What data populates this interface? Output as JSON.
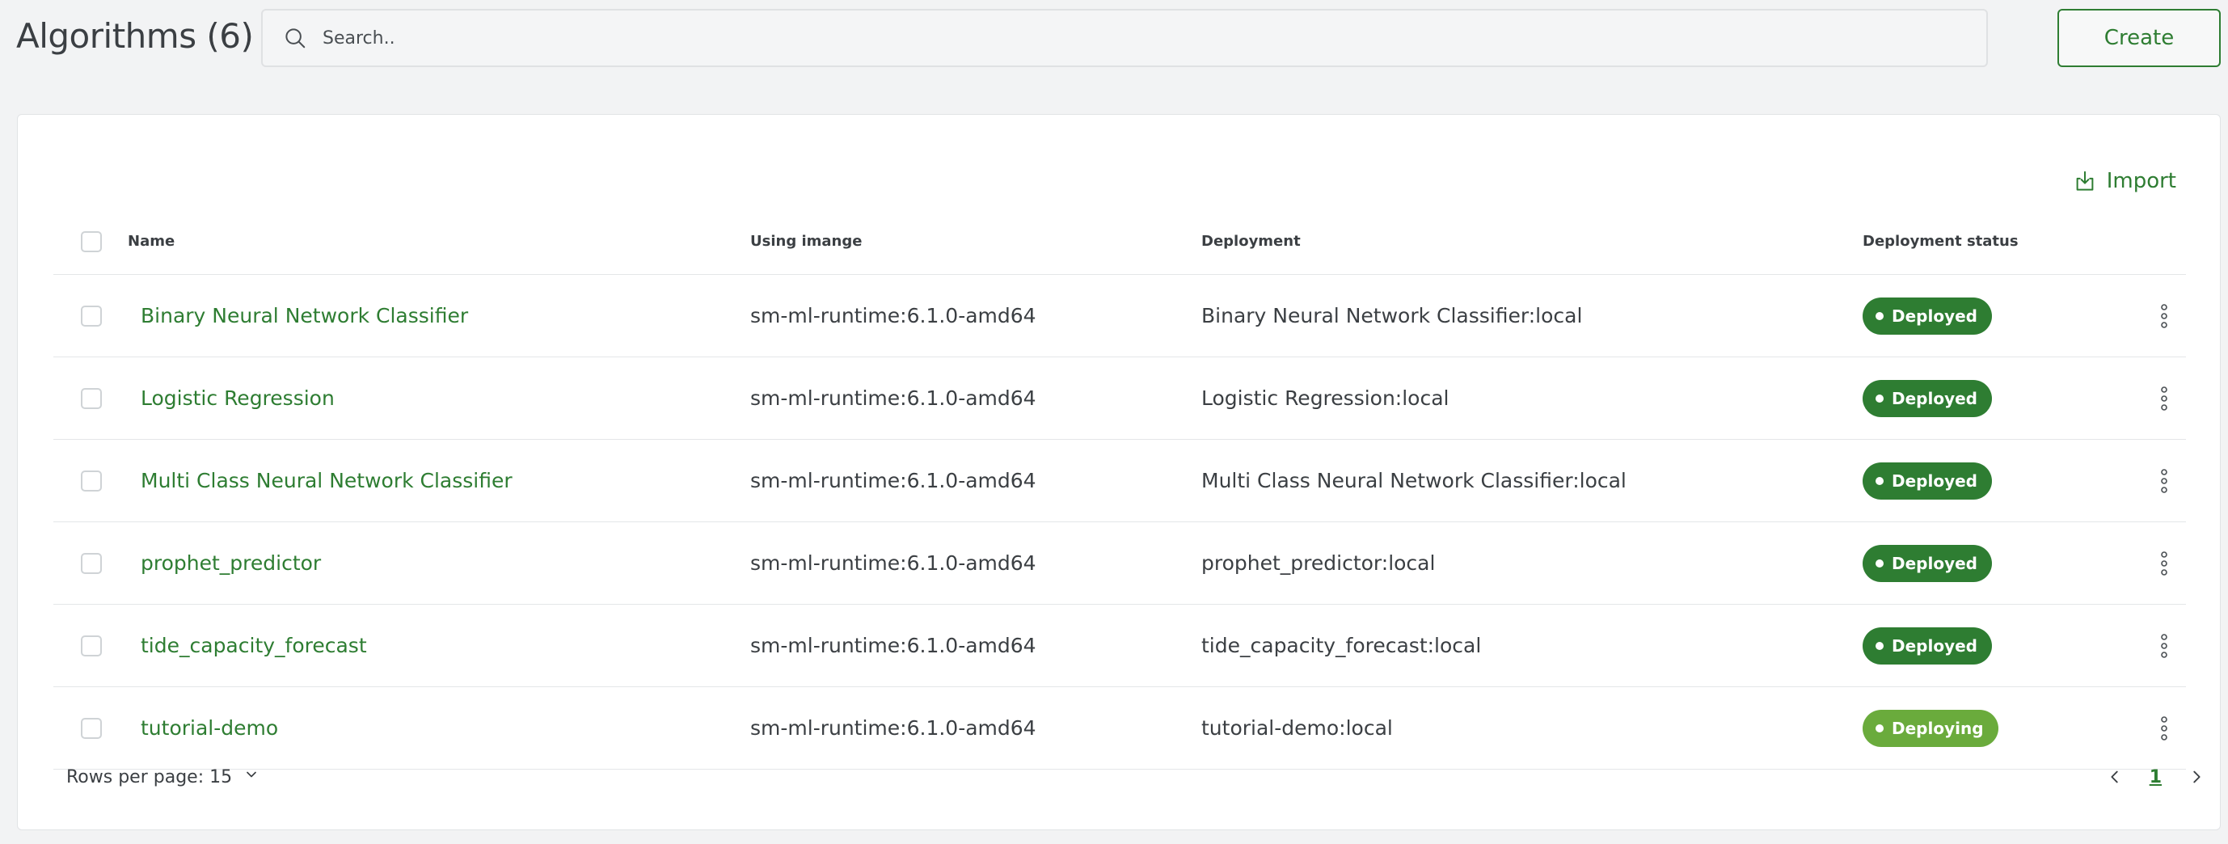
{
  "header": {
    "title": "Algorithms (6)",
    "search_placeholder": "Search..",
    "create_label": "Create"
  },
  "toolbar": {
    "import_label": "Import"
  },
  "table": {
    "columns": {
      "name": "Name",
      "image": "Using imange",
      "deployment": "Deployment",
      "status": "Deployment status"
    },
    "rows": [
      {
        "name": "Binary Neural Network Classifier",
        "image": "sm-ml-runtime:6.1.0-amd64",
        "deployment": "Binary Neural Network Classifier:local",
        "status": "Deployed"
      },
      {
        "name": "Logistic Regression",
        "image": "sm-ml-runtime:6.1.0-amd64",
        "deployment": "Logistic Regression:local",
        "status": "Deployed"
      },
      {
        "name": "Multi Class Neural Network Classifier",
        "image": "sm-ml-runtime:6.1.0-amd64",
        "deployment": "Multi Class Neural Network Classifier:local",
        "status": "Deployed"
      },
      {
        "name": "prophet_predictor",
        "image": "sm-ml-runtime:6.1.0-amd64",
        "deployment": "prophet_predictor:local",
        "status": "Deployed"
      },
      {
        "name": "tide_capacity_forecast",
        "image": "sm-ml-runtime:6.1.0-amd64",
        "deployment": "tide_capacity_forecast:local",
        "status": "Deployed"
      },
      {
        "name": "tutorial-demo",
        "image": "sm-ml-runtime:6.1.0-amd64",
        "deployment": "tutorial-demo:local",
        "status": "Deploying"
      }
    ]
  },
  "footer": {
    "rows_per_page": "Rows per page: 15",
    "current_page": "1"
  },
  "colors": {
    "accent": "#2e7d32",
    "deploying": "#6aab3c",
    "background": "#f2f3f4"
  },
  "icons": {
    "search": "search-icon",
    "import": "import-icon",
    "menu": "more-vertical-icon",
    "chevron_down": "chevron-down-icon",
    "prev": "chevron-left-icon",
    "next": "chevron-right-icon"
  }
}
